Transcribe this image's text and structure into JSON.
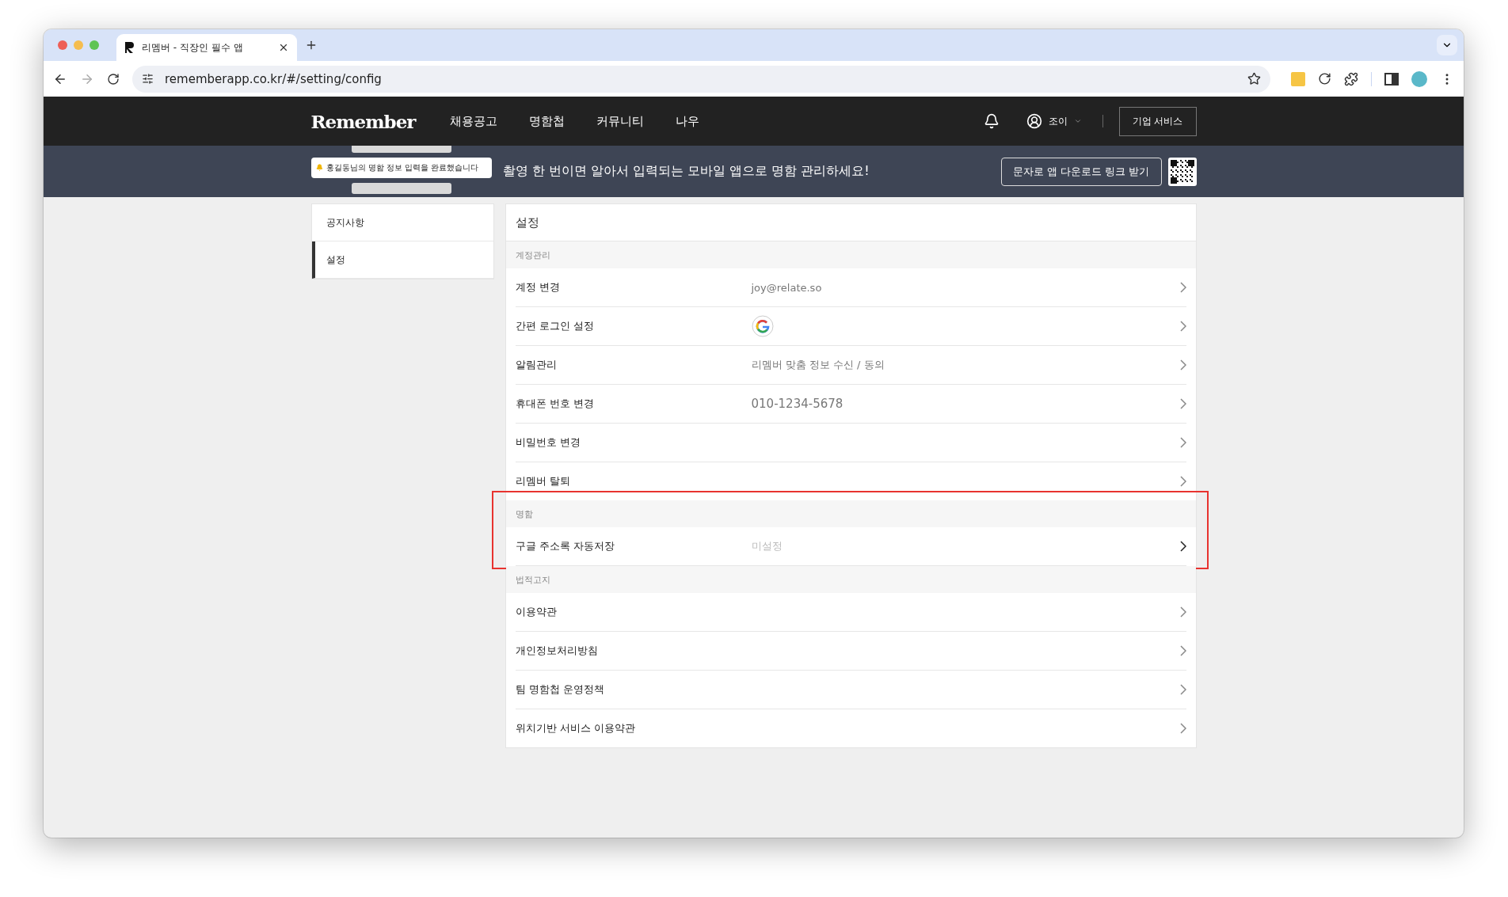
{
  "browser": {
    "tab_title": "리멤버 - 직장인 필수 앱",
    "url": "rememberapp.co.kr/#/setting/config",
    "forward_disabled": true
  },
  "nav": {
    "logo": "Remember",
    "menu": [
      "채용공고",
      "명함첩",
      "커뮤니티",
      "나우"
    ],
    "user": "조이",
    "business_button": "기업 서비스"
  },
  "banner": {
    "notification": "홍길동님의 명함 정보 입력을 완료했습니다",
    "headline": "촬영 한 번이면 알아서 입력되는 모바일 앱으로 명함 관리하세요!",
    "button": "문자로 앱 다운로드 링크 받기"
  },
  "sidebar": {
    "items": [
      {
        "label": "공지사항",
        "selected": false
      },
      {
        "label": "설정",
        "selected": true
      }
    ]
  },
  "panel": {
    "title": "설정",
    "sections": [
      {
        "title": "계정관리",
        "highlighted": false,
        "rows": [
          {
            "label": "계정 변경",
            "kind": "text",
            "value": "joy@relate.so"
          },
          {
            "label": "간편 로그인 설정",
            "kind": "google"
          },
          {
            "label": "알림관리",
            "kind": "text",
            "value": "리멤버 맞춤 정보 수신 / 동의"
          },
          {
            "label": "휴대폰 번호 변경",
            "kind": "number",
            "value": "010-1234-5678"
          },
          {
            "label": "비밀번호 변경",
            "kind": "none"
          },
          {
            "label": "리멤버 탈퇴",
            "kind": "none"
          }
        ]
      },
      {
        "title": "명함",
        "highlighted": true,
        "rows": [
          {
            "label": "구글 주소록 자동저장",
            "kind": "muted",
            "value": "미설정"
          }
        ]
      },
      {
        "title": "법적고지",
        "highlighted": false,
        "rows": [
          {
            "label": "이용약관",
            "kind": "none"
          },
          {
            "label": "개인정보처리방침",
            "kind": "none"
          },
          {
            "label": "팀 명함첩 운영정책",
            "kind": "none"
          },
          {
            "label": "위치기반 서비스 이용약관",
            "kind": "none"
          }
        ]
      }
    ]
  }
}
